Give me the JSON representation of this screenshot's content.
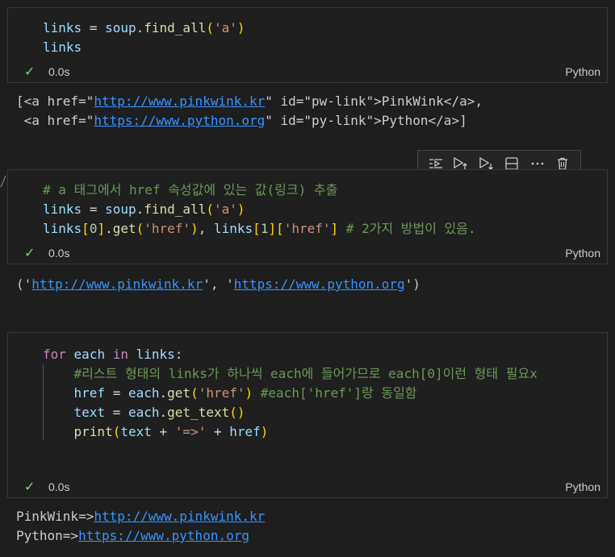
{
  "cell1": {
    "code": [
      "links = soup.find_all('a')",
      "links"
    ],
    "time": "0.0s",
    "lang": "Python",
    "output": {
      "line1_pre": "[<a href=\"",
      "line1_link": "http://www.pinkwink.kr",
      "line1_post": "\" id=\"pw-link\">PinkWink</a>,",
      "line2_pre": " <a href=\"",
      "line2_link": "https://www.python.org",
      "line2_post": "\" id=\"py-link\">Python</a>]"
    }
  },
  "cell2": {
    "comment": "# a 태그에서 href 속성값에 있는 값(링크) 추출",
    "time": "0.0s",
    "lang": "Python",
    "line3_comment": "# 2가지 방법이 있음.",
    "output": {
      "pre": "('",
      "link1": "http://www.pinkwink.kr",
      "mid": "', '",
      "link2": "https://www.python.org",
      "post": "')"
    }
  },
  "cell3": {
    "comment1": "#리스트 형태의 links가 하나씩 each에 들어가므로 each[0]이런 형태 필요x",
    "comment2": "#each['href']랑 동일함",
    "time": "0.0s",
    "lang": "Python",
    "output": {
      "line1_pre": "PinkWink=>",
      "line1_link": "http://www.pinkwink.kr",
      "line2_pre": "Python=>",
      "line2_link": "https://www.python.org"
    }
  },
  "toolbar": {
    "icons": [
      "run-by-line-icon",
      "execute-above-icon",
      "execute-below-icon",
      "split-cell-icon",
      "more-actions-icon",
      "delete-cell-icon"
    ]
  },
  "colors": {
    "background": "#1e1e1e",
    "link": "#3794ff",
    "check": "#89d185",
    "comment": "#6a9955",
    "string": "#ce9178"
  }
}
